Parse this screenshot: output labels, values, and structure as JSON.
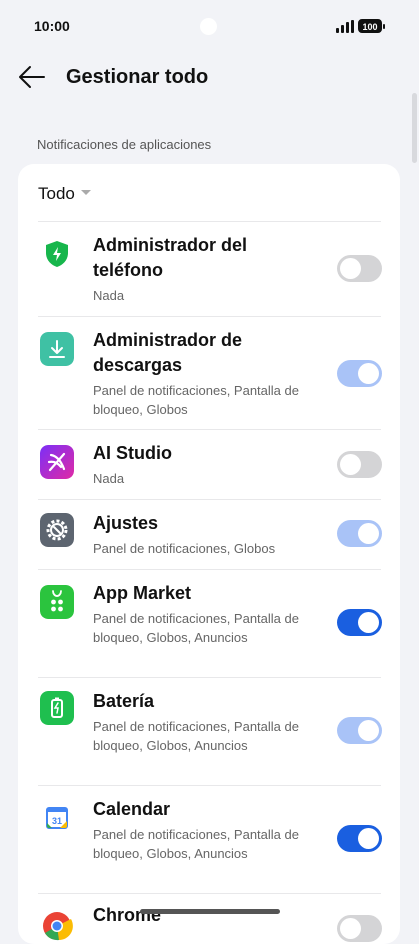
{
  "status_bar": {
    "time": "10:00",
    "battery": "100"
  },
  "header": {
    "title": "Gestionar todo"
  },
  "section_label": "Notificaciones de aplicaciones",
  "filter": {
    "selected": "Todo"
  },
  "apps": [
    {
      "name": "Administrador del teléfono",
      "description": "Nada",
      "toggle": "off",
      "icon": "shield-bolt-icon"
    },
    {
      "name": "Administrador de descargas",
      "description": "Panel de notificaciones, Pantalla de bloqueo, Globos",
      "toggle": "on-disabled",
      "icon": "download-icon"
    },
    {
      "name": "AI Studio",
      "description": "Nada",
      "toggle": "off",
      "icon": "ai-studio-icon"
    },
    {
      "name": "Ajustes",
      "description": "Panel de notificaciones, Globos",
      "toggle": "on-disabled",
      "icon": "gear-icon"
    },
    {
      "name": "App Market",
      "description": "Panel de notificaciones, Pantalla de bloqueo, Globos, Anuncios",
      "toggle": "on",
      "icon": "app-market-icon"
    },
    {
      "name": "Batería",
      "description": "Panel de notificaciones, Pantalla de bloqueo, Globos, Anuncios",
      "toggle": "on-disabled",
      "icon": "battery-icon"
    },
    {
      "name": "Calendar",
      "description": "Panel de notificaciones, Pantalla de bloqueo, Globos, Anuncios",
      "toggle": "on",
      "icon": "calendar-icon"
    },
    {
      "name": "Chrome",
      "description": "",
      "toggle": "off",
      "icon": "chrome-icon"
    }
  ],
  "calendar_icon_day": "31",
  "colors": {
    "toggle_on": "#1a5fe0",
    "toggle_disabled_on": "#a9c3f7",
    "toggle_off": "#d4d4d6"
  }
}
